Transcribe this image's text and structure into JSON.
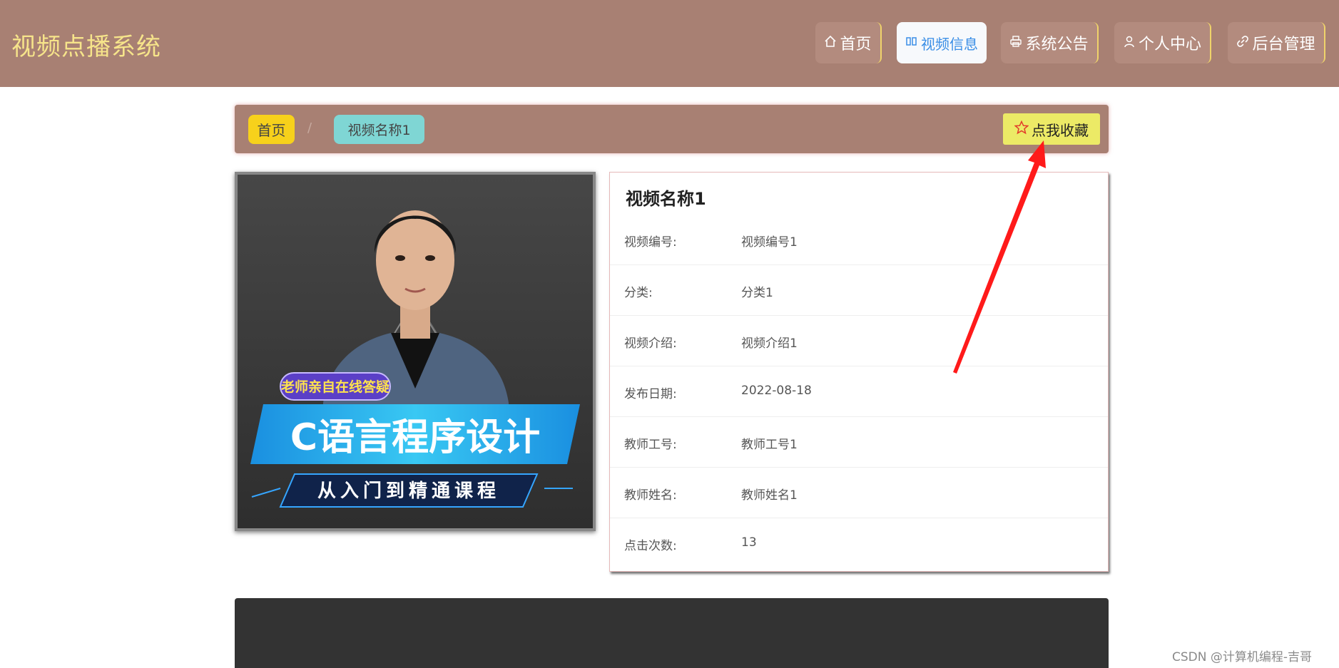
{
  "app": {
    "title": "视频点播系统"
  },
  "nav": {
    "items": [
      {
        "label": "首页",
        "icon": "home-icon"
      },
      {
        "label": "视频信息",
        "icon": "video-icon"
      },
      {
        "label": "系统公告",
        "icon": "printer-icon"
      },
      {
        "label": "个人中心",
        "icon": "user-icon"
      },
      {
        "label": "后台管理",
        "icon": "link-icon"
      }
    ],
    "active_index": 1
  },
  "breadcrumb": {
    "home": "首页",
    "separator": "/",
    "current": "视频名称1"
  },
  "favorite": {
    "label": "点我收藏",
    "icon": "star-icon"
  },
  "cover": {
    "badge": "老师亲自在线答疑",
    "title": "C语言程序设计",
    "subtitle": "从入门到精通课程"
  },
  "detail": {
    "title": "视频名称1",
    "fields": [
      {
        "label": "视频编号:",
        "value": "视频编号1"
      },
      {
        "label": "分类:",
        "value": "分类1"
      },
      {
        "label": "视频介绍:",
        "value": "视频介绍1"
      },
      {
        "label": "发布日期:",
        "value": "2022-08-18"
      },
      {
        "label": "教师工号:",
        "value": "教师工号1"
      },
      {
        "label": "教师姓名:",
        "value": "教师姓名1"
      },
      {
        "label": "点击次数:",
        "value": "13"
      }
    ]
  },
  "watermark": "CSDN @计算机编程-吉哥",
  "colors": {
    "header_bg": "#a88073",
    "brand_text": "#f6e48a",
    "nav_active_text": "#3a8ee6",
    "crumb_home_bg": "#f7d11b",
    "crumb_current_bg": "#7fd6d4",
    "favorite_bg": "#ecea66",
    "annotation_arrow": "#ff1a1a"
  }
}
